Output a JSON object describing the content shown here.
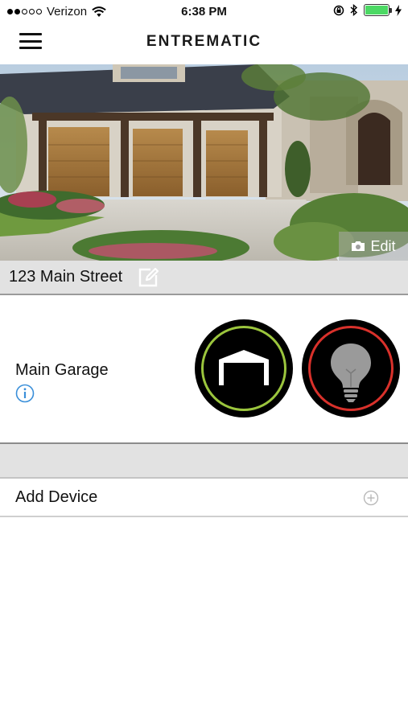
{
  "status_bar": {
    "carrier": "Verizon",
    "time": "6:38 PM",
    "signal_bars_filled": 2,
    "signal_bars_total": 5,
    "battery_level": 1.0,
    "battery_color": "#4cd964"
  },
  "header": {
    "menu_icon": "hamburger-menu-icon",
    "brand": "ENTREMATIC"
  },
  "hero": {
    "edit_label": "Edit",
    "edit_icon": "camera-icon"
  },
  "location": {
    "address": "123 Main Street",
    "edit_icon": "edit-square-icon"
  },
  "devices": [
    {
      "name": "Main Garage",
      "info_icon": "info-circle-icon",
      "garage_button": {
        "icon": "garage-door-icon",
        "ring_color": "#9bc53d"
      },
      "light_button": {
        "icon": "light-bulb-icon",
        "ring_color": "#d9312b"
      }
    }
  ],
  "add_device": {
    "label": "Add Device",
    "icon": "plus-circle-icon"
  }
}
